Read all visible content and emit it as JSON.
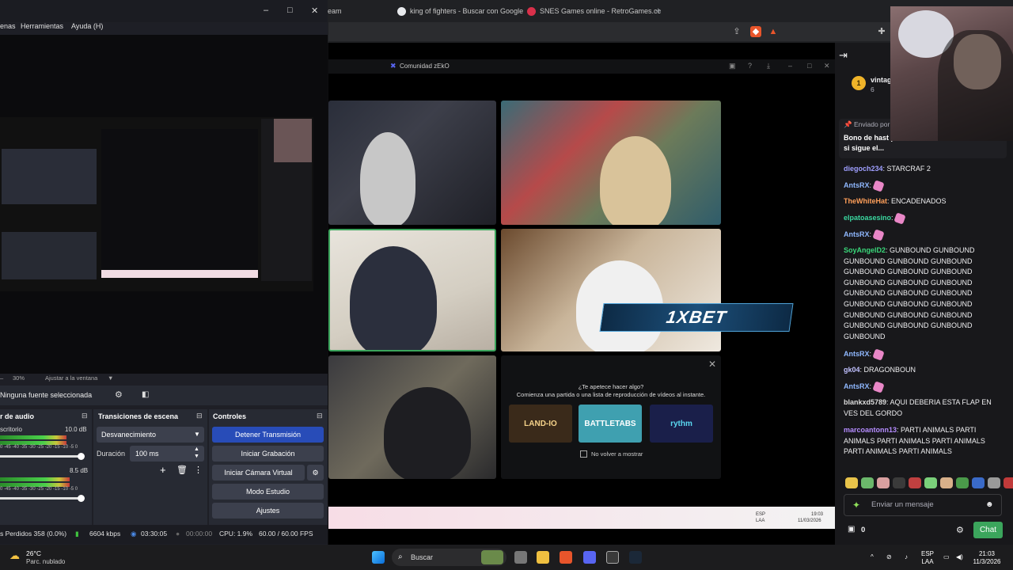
{
  "browser": {
    "tabs": [
      {
        "label": "eam"
      },
      {
        "label": "king of fighters - Buscar con Google"
      },
      {
        "label": "SNES Games online - RetroGames.cc"
      }
    ],
    "new_tab": "+"
  },
  "discord": {
    "title": "Comunidad zEkO",
    "promo_title": "¿Te apetece hacer algo?",
    "promo_sub": "Comienza una partida o una lista de reproducción de vídeos al instante.",
    "games": [
      "LAND-IO",
      "BATTLETABS",
      "rythm"
    ],
    "promo_checkbox": "No volver a mostrar",
    "promo_close": "✕"
  },
  "stream_overlay": {
    "bet_banner": "1XBET",
    "inner_lang": "ESP",
    "inner_layout": "LAA",
    "inner_time": "19:03",
    "inner_date": "11/03/2026"
  },
  "chat": {
    "top_user": "vintag",
    "top_count": "6",
    "top_rank": "1",
    "pinned_by": "Enviado por",
    "pinned_text": "Bono de hast promocional GOTTO1X si sigue el...",
    "messages": [
      {
        "user": "diegoch234",
        "color": "#9f9fff",
        "text": "STARCRAF 2",
        "emote": false
      },
      {
        "user": "AntsRX",
        "color": "#8fb8ff",
        "text": "",
        "emote": true
      },
      {
        "user": "TheWhiteHat",
        "color": "#ff9f5a",
        "text": "ENCADENADOS",
        "emote": false
      },
      {
        "user": "elpatoasesino",
        "color": "#3ad8a0",
        "text": "",
        "emote": true
      },
      {
        "user": "AntsRX",
        "color": "#8fb8ff",
        "text": "",
        "emote": true
      },
      {
        "user": "SoyAngelD2",
        "color": "#3ad87a",
        "text": "GUNBOUND GUNBOUND GUNBOUND GUNBOUND GUNBOUND GUNBOUND GUNBOUND GUNBOUND GUNBOUND GUNBOUND GUNBOUND GUNBOUND GUNBOUND GUNBOUND GUNBOUND GUNBOUND GUNBOUND GUNBOUND GUNBOUND GUNBOUND GUNBOUND GUNBOUND GUNBOUND GUNBOUND",
        "emote": false
      },
      {
        "user": "AntsRX",
        "color": "#8fb8ff",
        "text": "",
        "emote": true
      },
      {
        "user": "gk04",
        "color": "#c0c0ff",
        "text": "DRAGONBOUN",
        "emote": false
      },
      {
        "user": "AntsRX",
        "color": "#8fb8ff",
        "text": "",
        "emote": true
      },
      {
        "user": "blankxd5789",
        "color": "#dcdcdc",
        "text": "AQUI DEBERIA ESTA FLAP EN VES DEL GORDO",
        "emote": false
      },
      {
        "user": "marcoantonn13",
        "color": "#b58cff",
        "text": "PARTI ANIMALS PARTI ANIMALS PARTI ANIMALS PARTI ANIMALS PARTI ANIMALS PARTI ANIMALS",
        "emote": false
      }
    ],
    "input_placeholder": "Enviar un mensaje",
    "points": "0",
    "chat_button": "Chat"
  },
  "obs": {
    "menu": [
      "enas",
      "Herramientas",
      "Ayuda (H)"
    ],
    "zoom": "30%",
    "fit": "Ajustar a la ventana",
    "source_selected": "Ninguna fuente seleccionada",
    "audio_header": "r de audio",
    "audio_tracks": [
      {
        "label": "scritorio",
        "db": "10.0 dB"
      },
      {
        "label": "",
        "db": "8.5 dB"
      }
    ],
    "meter_scale": "0 -45 -40 -35 -30 -25 -20 -15 -10 -5 0",
    "transitions_header": "Transiciones de escena",
    "transition": "Desvanecimiento",
    "duration_label": "Duración",
    "duration": "100 ms",
    "controls_header": "Controles",
    "buttons": {
      "stop_stream": "Detener Transmisión",
      "start_rec": "Iniciar Grabación",
      "virtual_cam": "Iniciar Cámara Virtual",
      "studio_mode": "Modo Estudio",
      "settings": "Ajustes"
    },
    "status": {
      "dropped": "s Perdidos 358 (0.0%)",
      "bitrate": "6604 kbps",
      "live_time": "03:30:05",
      "rec_time": "00:00:00",
      "cpu": "CPU: 1.9%",
      "fps": "60.00 / 60.00 FPS"
    }
  },
  "taskbar": {
    "weather_temp": "26°C",
    "weather_desc": "Parc. nublado",
    "search": "Buscar",
    "lang": "ESP",
    "layout": "LAA",
    "time": "21:03",
    "date": "11/3/2026"
  }
}
